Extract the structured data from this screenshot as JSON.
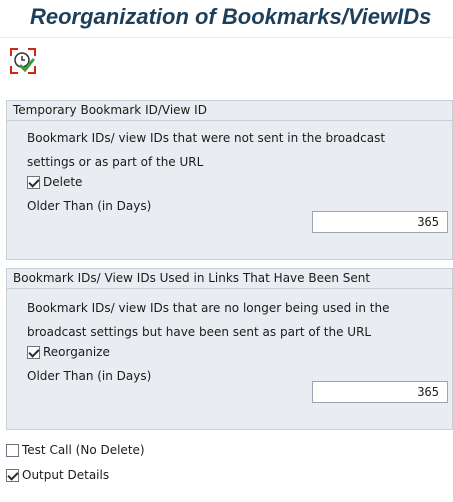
{
  "title": "Reorganization of Bookmarks/ViewIDs",
  "toolbar": {
    "execute_icon": "execute-clock-icon"
  },
  "group1": {
    "header": "Temporary Bookmark ID/View ID",
    "desc_line1": "Bookmark IDs/ view IDs that were not sent in the broadcast",
    "desc_line2": "settings or as part of the URL",
    "checkbox_label": "Delete",
    "checkbox_checked": true,
    "older_label": "Older Than (in Days)",
    "older_value": "365"
  },
  "group2": {
    "header": "Bookmark IDs/ View IDs Used in Links That Have Been Sent",
    "desc_line1": "Bookmark IDs/ view IDs that are no longer being used in the",
    "desc_line2": "broadcast settings but have been sent as part of the URL",
    "checkbox_label": "Reorganize",
    "checkbox_checked": true,
    "older_label": "Older Than (in Days)",
    "older_value": "365"
  },
  "options": {
    "test_call_label": "Test Call (No Delete)",
    "test_call_checked": false,
    "output_details_label": "Output Details",
    "output_details_checked": true
  },
  "colors": {
    "title": "#1e3f5a",
    "group_bg": "#e9edf1",
    "group_border": "#c7d0d8",
    "execute_red": "#d0271d",
    "execute_green": "#3d9a3d"
  }
}
